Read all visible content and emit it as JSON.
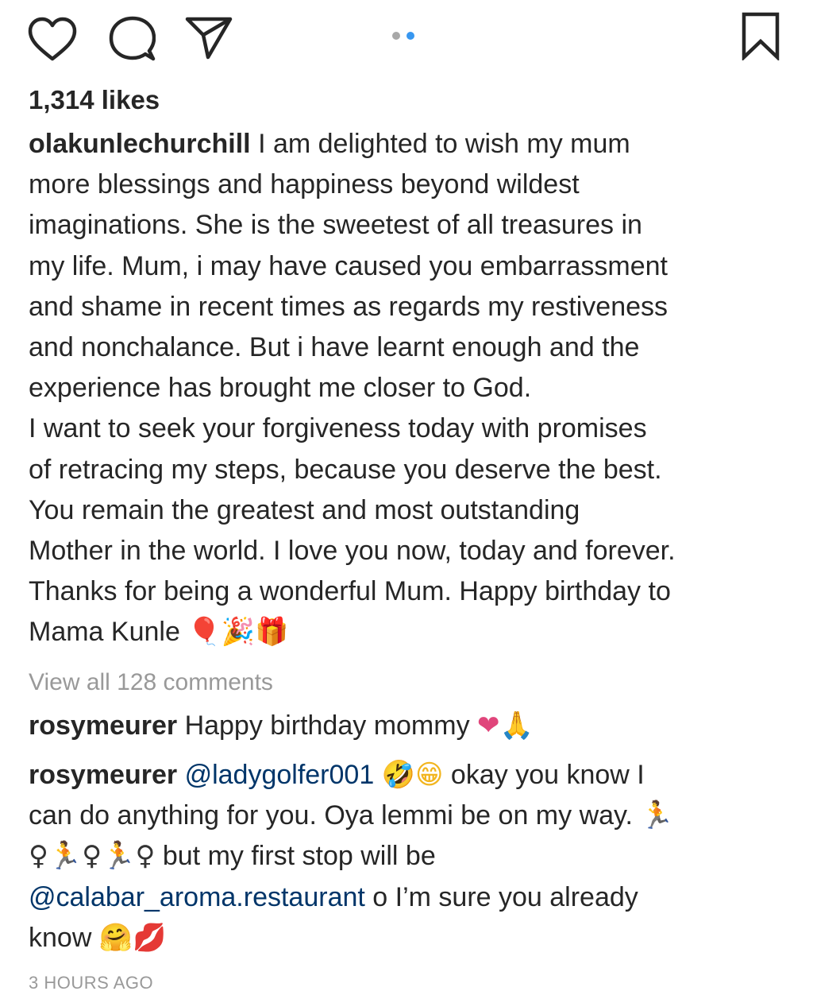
{
  "icons": {
    "like": "heart-outline-icon",
    "comment": "speech-bubble-icon",
    "share": "paper-plane-icon",
    "save": "bookmark-icon"
  },
  "carousel": {
    "total": 2,
    "active": 2,
    "inactive_color": "#a8a8a8",
    "active_color": "#3897f0"
  },
  "likes": "1,314 likes",
  "caption": {
    "username": "olakunlechurchill",
    "lines": [
      "I am delighted to wish my mum",
      "more blessings and happiness beyond wildest",
      "imaginations. She is the sweetest of all treasures in",
      "my life. Mum, i may have caused you embarrassment",
      "and shame in recent times as regards my restiveness",
      "and nonchalance. But i have learnt enough and the",
      "experience has brought me closer to God.",
      "I want to seek your forgiveness today with promises",
      "of retracing my steps, because you deserve the best.",
      "You remain the greatest and most outstanding",
      "Mother in the world. I love you now, today and forever.",
      "Thanks for being a wonderful Mum. Happy birthday to",
      "Mama Kunle "
    ],
    "emojis": [
      "🎈",
      "🎉",
      "🎁"
    ]
  },
  "view_all_comments": "View all 128 comments",
  "comments": [
    {
      "username": "rosymeurer",
      "text": "Happy birthday mommy ",
      "emojis": [
        "❤",
        "🙏"
      ]
    },
    {
      "username": "rosymeurer",
      "mention1": "@ladygolfer001",
      "emojis_a": [
        "🤣",
        "😁"
      ],
      "text_a": " okay you know I",
      "text_b": "can do anything for you. Oya lemmi be on my way. ",
      "run": "🏃",
      "female": "♀",
      "text_c": " but my first stop will be",
      "mention2": "@calabar_aroma.restaurant",
      "text_d": " o I’m sure you already",
      "text_e": "know ",
      "emojis_b": [
        "🤗",
        "💋"
      ]
    }
  ],
  "timestamp": "3 HOURS AGO"
}
